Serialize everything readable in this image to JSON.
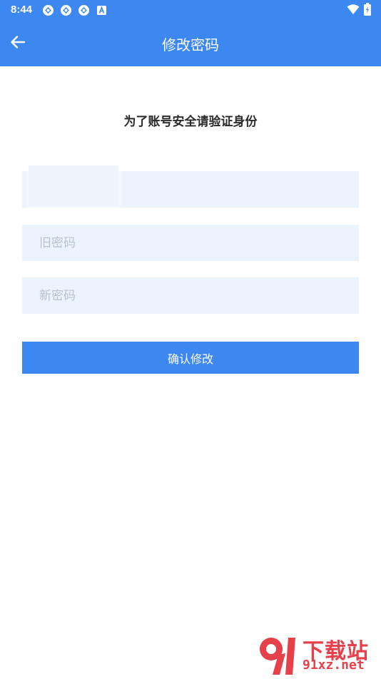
{
  "status_bar": {
    "time": "8:44",
    "left_icons": [
      "sync-icon",
      "sync-icon",
      "sync-icon",
      "a-icon"
    ],
    "right_icons": [
      "wifi-icon",
      "battery-icon"
    ]
  },
  "header": {
    "title": "修改密码",
    "back_icon": "arrow-left-icon",
    "background": "#3d87f0"
  },
  "main": {
    "subtitle": "为了账号安全请验证身份",
    "account_field": {
      "value": "",
      "placeholder": ""
    },
    "old_password_field": {
      "placeholder": "旧密码"
    },
    "new_password_field": {
      "placeholder": "新密码"
    },
    "confirm_button_label": "确认修改"
  },
  "watermark": {
    "logo_text": "91",
    "cn_text": "下载站",
    "url_text": "91xz.net"
  },
  "colors": {
    "accent": "#3d87f0",
    "field_bg": "#eaf3fe",
    "watermark": "#e6404a"
  }
}
